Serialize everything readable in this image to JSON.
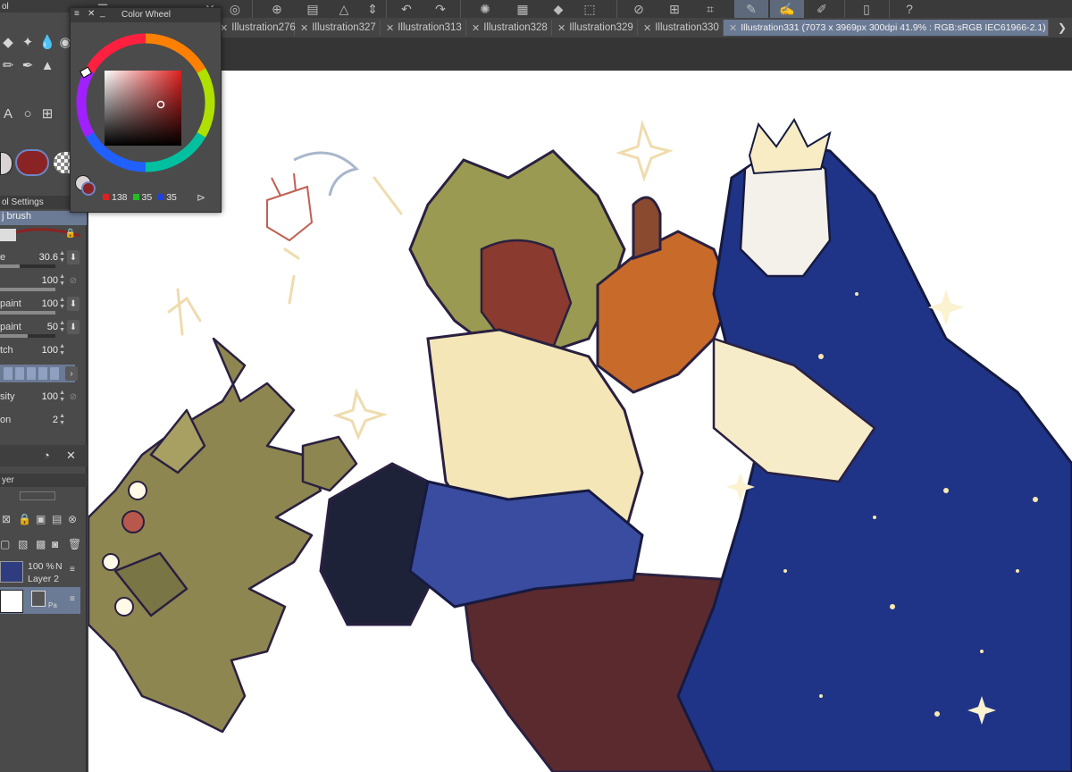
{
  "document_tabs": [
    {
      "label": "Illustration276",
      "active": false
    },
    {
      "label": "Illustration327",
      "active": false
    },
    {
      "label": "Illustration313",
      "active": false
    },
    {
      "label": "Illustration328",
      "active": false
    },
    {
      "label": "Illustration329",
      "active": false
    },
    {
      "label": "Illustration330",
      "active": false
    },
    {
      "label": "Illustration331 (7073 x 3969px 300dpi 41.9% : RGB:sRGB IEC61966-2.1)",
      "active": true
    }
  ],
  "color_wheel": {
    "title": "Color Wheel",
    "r": "138",
    "g": "35",
    "b": "35",
    "current_color": "#8a2323"
  },
  "tool_property": {
    "panel_title": "ol Settings",
    "brush_name": "j brush",
    "rows": [
      {
        "label": "e",
        "value": "30.6"
      },
      {
        "label": "",
        "value": "100"
      },
      {
        "label": "paint",
        "value": "100"
      },
      {
        "label": "paint",
        "value": "50"
      },
      {
        "label": "tch",
        "value": "100"
      },
      {
        "label": "sity",
        "value": "100"
      },
      {
        "label": "on",
        "value": "2"
      }
    ]
  },
  "sub_tool_header": "ol",
  "layer_panel": {
    "header": "yer",
    "layers": [
      {
        "opacity": "100 %",
        "blend_abbrev": "N",
        "name": "Layer 2"
      },
      {
        "opacity": "",
        "blend_abbrev": "",
        "name": "Pa"
      }
    ]
  },
  "colors": {
    "panel_bg": "#4a4a4a",
    "active_tab": "#6b7a95",
    "main_color": "#d9d3d3",
    "sub_color": "#8a2323"
  }
}
